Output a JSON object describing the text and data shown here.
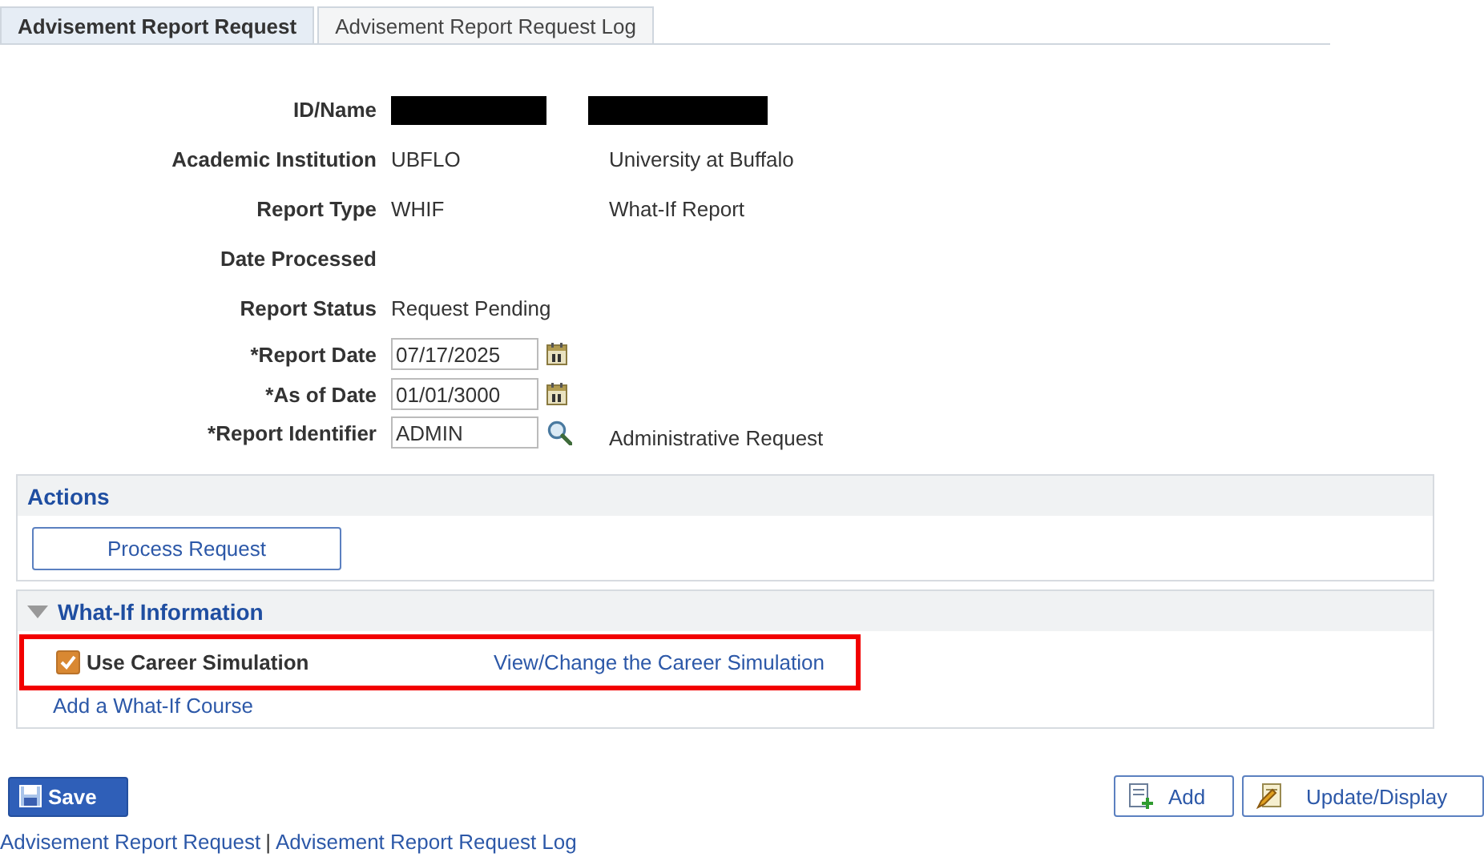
{
  "tabs": [
    {
      "label": "Advisement Report Request",
      "selected": true
    },
    {
      "label": "Advisement Report Request Log",
      "selected": false
    }
  ],
  "fields": [
    {
      "kind": "redacted",
      "label": "ID/Name"
    },
    {
      "kind": "text",
      "label": "Academic Institution",
      "value": "UBFLO",
      "description": "University at Buffalo"
    },
    {
      "kind": "text",
      "label": "Report Type",
      "value": "WHIF",
      "description": "What-If Report"
    },
    {
      "kind": "text",
      "label": "Date Processed"
    },
    {
      "kind": "text",
      "label": "Report Status",
      "value": "Request Pending"
    },
    {
      "kind": "date",
      "label": "*Report Date",
      "value": "07/17/2025"
    },
    {
      "kind": "date",
      "label": "*As of Date",
      "value": "01/01/3000"
    },
    {
      "kind": "lookup",
      "label": "*Report Identifier",
      "value": "ADMIN",
      "description": "Administrative Request"
    }
  ],
  "actions": {
    "title": "Actions",
    "button": "Process Request"
  },
  "what_if": {
    "title": "What-If Information",
    "expanded": true,
    "checkbox": {
      "label": "Use Career Simulation",
      "checked": true,
      "highlighted": true
    },
    "link": "View/Change the Career Simulation",
    "add_link": "Add a What-If Course"
  },
  "save_button": "Save",
  "buttons": [
    "Add",
    "Update/Display"
  ],
  "footer_links": [
    "Advisement Report Request",
    "Advisement Report Request Log"
  ],
  "footer_separator": "|"
}
